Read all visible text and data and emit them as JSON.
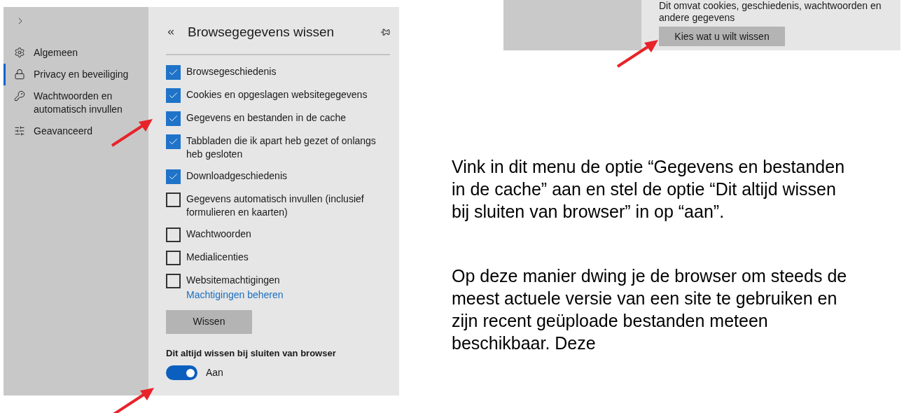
{
  "settings_sidebar": {
    "items": [
      {
        "label": "Algemeen",
        "selected": false
      },
      {
        "label": "Privacy en beveiliging",
        "selected": true
      },
      {
        "label": "Wachtwoorden en automatisch invullen",
        "selected": false
      },
      {
        "label": "Geavanceerd",
        "selected": false
      }
    ]
  },
  "clear_panel": {
    "title": "Browsegegevens wissen",
    "options": [
      {
        "label": "Browsegeschiedenis",
        "checked": true
      },
      {
        "label": "Cookies en opgeslagen websitegegevens",
        "checked": true
      },
      {
        "label": "Gegevens en bestanden in de cache",
        "checked": true
      },
      {
        "label": "Tabbladen die ik apart heb gezet of onlangs heb gesloten",
        "checked": true
      },
      {
        "label": "Downloadgeschiedenis",
        "checked": true
      },
      {
        "label": "Gegevens automatisch invullen (inclusief formulieren en kaarten)",
        "checked": false
      },
      {
        "label": "Wachtwoorden",
        "checked": false
      },
      {
        "label": "Medialicenties",
        "checked": false
      },
      {
        "label": "Websitemachtigingen",
        "checked": false
      }
    ],
    "link": "Machtigingen beheren",
    "clear_button": "Wissen",
    "toggle": {
      "label": "Dit altijd wissen bij sluiten van browser",
      "on": true,
      "state_label": "Aan"
    }
  },
  "privacy_snippet": {
    "description": "Dit omvat cookies, geschiedenis, wachtwoorden en andere gegevens",
    "button": "Kies wat u wilt wissen"
  },
  "paragraphs": [
    "Vink in dit menu de optie “Gegevens en bestanden in de cache” aan en stel de optie “Dit altijd wissen bij sluiten van browser” in op “aan”.",
    "Op deze manier dwing je de browser om steeds de meest actuele versie van een site te gebruiken en zijn recent geüploade bestanden meteen beschikbaar. Deze"
  ]
}
